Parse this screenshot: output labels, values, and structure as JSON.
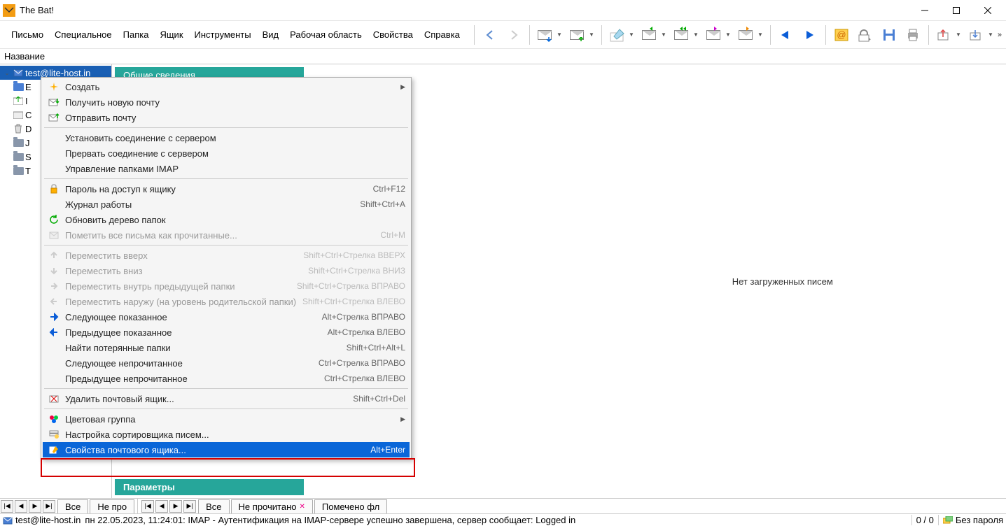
{
  "app": {
    "title": "The Bat!"
  },
  "menubar": [
    "Письмо",
    "Специальное",
    "Папка",
    "Ящик",
    "Инструменты",
    "Вид",
    "Рабочая область",
    "Свойства",
    "Справка"
  ],
  "column_header": "Название",
  "tree": {
    "account": "test@lite-host.in",
    "folders": [
      "E",
      "I",
      "C",
      "D",
      "J",
      "S",
      "T"
    ]
  },
  "info_tab": "Общие сведения",
  "params_tab": "Параметры",
  "empty_msg": "Нет загруженных писем",
  "ctx": [
    {
      "type": "item",
      "label": "Создать",
      "submenu": true,
      "icon": "sparkle"
    },
    {
      "type": "item",
      "label": "Получить новую почту",
      "icon": "mail-down"
    },
    {
      "type": "item",
      "label": "Отправить почту",
      "icon": "mail-up"
    },
    {
      "type": "sep"
    },
    {
      "type": "item",
      "label": "Установить соединение с сервером"
    },
    {
      "type": "item",
      "label": "Прервать соединение с сервером"
    },
    {
      "type": "item",
      "label": "Управление папками IMAP"
    },
    {
      "type": "sep"
    },
    {
      "type": "item",
      "label": "Пароль на доступ к ящику",
      "shortcut": "Ctrl+F12",
      "icon": "lock"
    },
    {
      "type": "item",
      "label": "Журнал работы",
      "shortcut": "Shift+Ctrl+A"
    },
    {
      "type": "item",
      "label": "Обновить дерево папок",
      "icon": "refresh"
    },
    {
      "type": "item",
      "label": "Пометить все письма как прочитанные...",
      "shortcut": "Ctrl+M",
      "disabled": true,
      "icon": "mail-grey"
    },
    {
      "type": "sep"
    },
    {
      "type": "item",
      "label": "Переместить вверх",
      "shortcut": "Shift+Ctrl+Стрелка ВВЕРХ",
      "disabled": true,
      "icon": "arrow-up"
    },
    {
      "type": "item",
      "label": "Переместить вниз",
      "shortcut": "Shift+Ctrl+Стрелка ВНИЗ",
      "disabled": true,
      "icon": "arrow-down"
    },
    {
      "type": "item",
      "label": "Переместить внутрь предыдущей папки",
      "shortcut": "Shift+Ctrl+Стрелка ВПРАВО",
      "disabled": true,
      "icon": "arrow-right"
    },
    {
      "type": "item",
      "label": "Переместить наружу (на уровень родительской папки)",
      "shortcut": "Shift+Ctrl+Стрелка ВЛЕВО",
      "disabled": true,
      "icon": "arrow-left"
    },
    {
      "type": "item",
      "label": "Следующее показанное",
      "shortcut": "Alt+Стрелка ВПРАВО",
      "icon": "arrow-right-blue"
    },
    {
      "type": "item",
      "label": "Предыдущее показанное",
      "shortcut": "Alt+Стрелка ВЛЕВО",
      "icon": "arrow-left-blue"
    },
    {
      "type": "item",
      "label": "Найти потерянные папки",
      "shortcut": "Shift+Ctrl+Alt+L"
    },
    {
      "type": "item",
      "label": "Следующее непрочитанное",
      "shortcut": "Ctrl+Стрелка ВПРАВО"
    },
    {
      "type": "item",
      "label": "Предыдущее непрочитанное",
      "shortcut": "Ctrl+Стрелка ВЛЕВО"
    },
    {
      "type": "sep"
    },
    {
      "type": "item",
      "label": "Удалить почтовый ящик...",
      "shortcut": "Shift+Ctrl+Del",
      "icon": "delete"
    },
    {
      "type": "sep"
    },
    {
      "type": "item",
      "label": "Цветовая группа",
      "submenu": true,
      "icon": "colors"
    },
    {
      "type": "item",
      "label": "Настройка сортировщика писем...",
      "icon": "filter"
    },
    {
      "type": "item",
      "label": "Свойства почтового ящика...",
      "shortcut": "Alt+Enter",
      "highlight": true,
      "icon": "props"
    }
  ],
  "bottom_tabs_left": [
    "Все",
    "Не про"
  ],
  "bottom_tabs_right": [
    "Все",
    "Не прочитано",
    "Помечено фл"
  ],
  "status": {
    "account": "test@lite-host.in",
    "log": "пн 22.05.2023, 11:24:01: IMAP  - Аутентификация на IMAP-сервере успешно завершена, сервер сообщает: Logged in",
    "count": "0 / 0",
    "pwd": "Без пароля"
  }
}
